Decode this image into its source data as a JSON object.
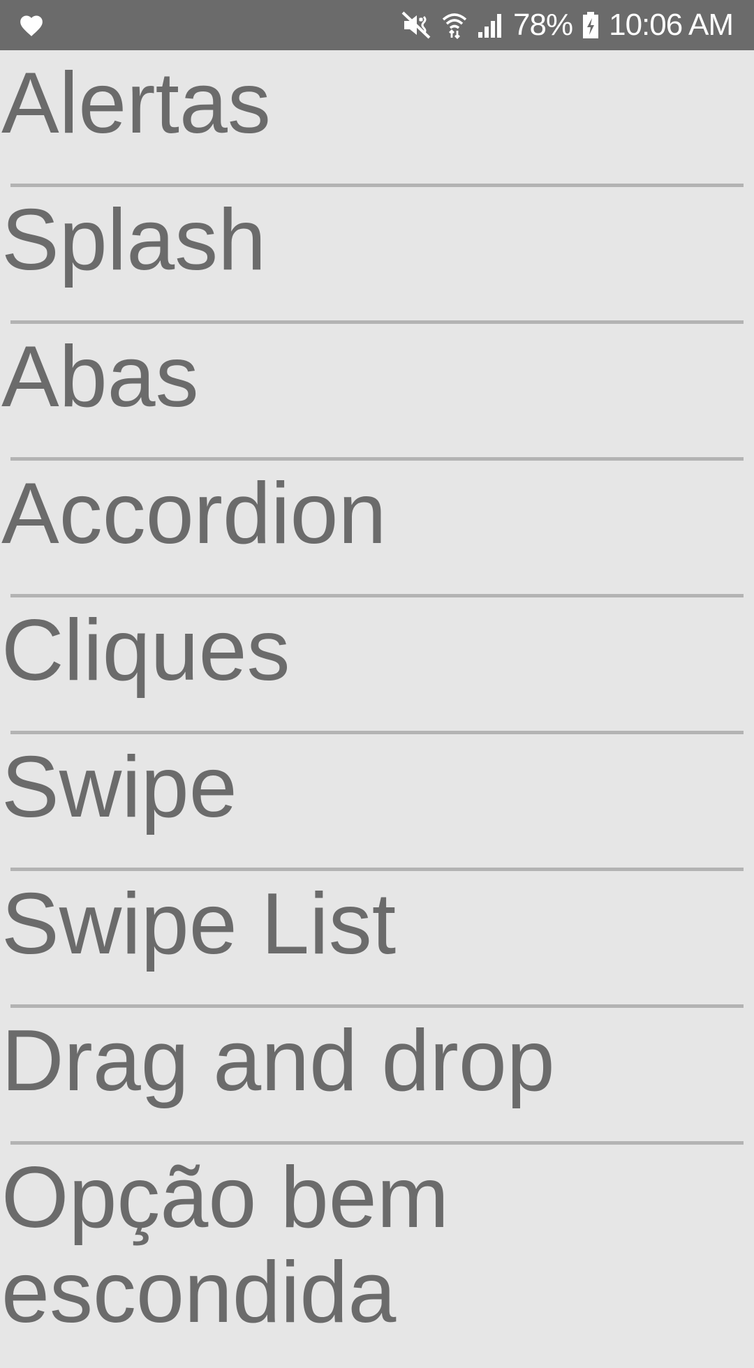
{
  "status_bar": {
    "battery": "78%",
    "time": "10:06 AM",
    "icons": [
      "heart-icon",
      "mute-icon",
      "wifi-icon",
      "signal-icon",
      "battery-charging-icon"
    ],
    "background": "#6b6b6b"
  },
  "menu": {
    "items": [
      {
        "label": "Alertas"
      },
      {
        "label": "Splash"
      },
      {
        "label": "Abas"
      },
      {
        "label": "Accordion"
      },
      {
        "label": "Cliques"
      },
      {
        "label": "Swipe"
      },
      {
        "label": "Swipe List"
      },
      {
        "label": "Drag and drop"
      },
      {
        "label": "Opção bem escondida"
      }
    ],
    "text_color": "#6b6b6b",
    "divider_color": "#b3b3b3",
    "background": "#e6e6e6"
  }
}
